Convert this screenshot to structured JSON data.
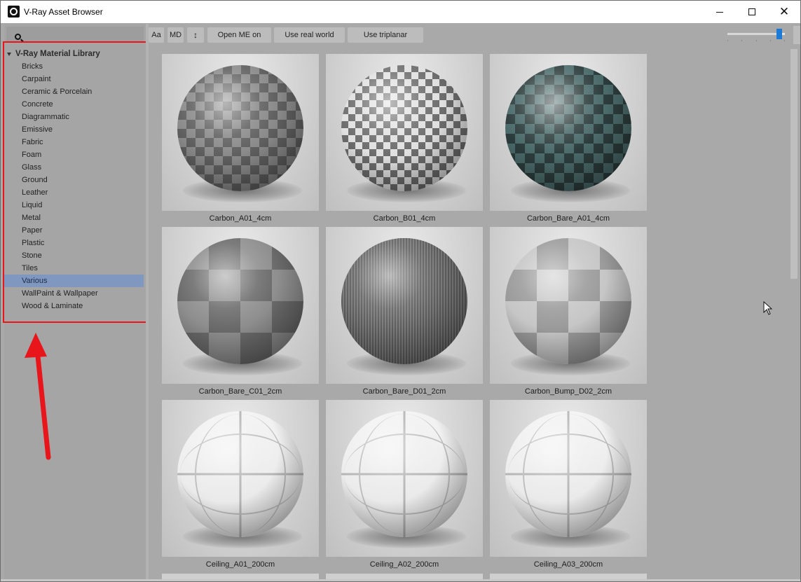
{
  "window": {
    "title": "V-Ray Asset Browser",
    "minimize_symbol": "",
    "close_symbol": "✕"
  },
  "search": {
    "placeholder": "",
    "value": ""
  },
  "tree": {
    "root_label": "V-Ray Material Library",
    "items": [
      {
        "label": "Bricks"
      },
      {
        "label": "Carpaint"
      },
      {
        "label": "Ceramic & Porcelain"
      },
      {
        "label": "Concrete"
      },
      {
        "label": "Diagrammatic"
      },
      {
        "label": "Emissive"
      },
      {
        "label": "Fabric"
      },
      {
        "label": "Foam"
      },
      {
        "label": "Glass"
      },
      {
        "label": "Ground"
      },
      {
        "label": "Leather"
      },
      {
        "label": "Liquid"
      },
      {
        "label": "Metal"
      },
      {
        "label": "Paper"
      },
      {
        "label": "Plastic"
      },
      {
        "label": "Stone"
      },
      {
        "label": "Tiles"
      },
      {
        "label": "Various",
        "selected": true
      },
      {
        "label": "WallPaint & Wallpaper"
      },
      {
        "label": "Wood & Laminate"
      }
    ]
  },
  "toolbar": {
    "aa_label": "Aa",
    "md_label": "MD",
    "sort_label": "↕",
    "open_me_label": "Open ME on apply",
    "real_world_label": "Use real world scale",
    "triplanar_label": "Use triplanar mapping",
    "thumbnail_size_fraction": 0.95
  },
  "materials": [
    {
      "name": "Carbon_A01_4cm",
      "pattern": "carbon-a"
    },
    {
      "name": "Carbon_B01_4cm",
      "pattern": "carbon-b"
    },
    {
      "name": "Carbon_Bare_A01_4cm",
      "pattern": "carbon-bare-a"
    },
    {
      "name": "Carbon_Bare_C01_2cm",
      "pattern": "carbon-c"
    },
    {
      "name": "Carbon_Bare_D01_2cm",
      "pattern": "carbon-d"
    },
    {
      "name": "Carbon_Bump_D02_2cm",
      "pattern": "carbon-bump"
    },
    {
      "name": "Ceiling_A01_200cm",
      "pattern": "ceiling"
    },
    {
      "name": "Ceiling_A02_200cm",
      "pattern": "ceiling"
    },
    {
      "name": "Ceiling_A03_200cm",
      "pattern": "ceiling"
    }
  ],
  "colors": {
    "selection": "#8097bf",
    "annotation_red": "#e8151b",
    "slider_accent": "#1b7bd6",
    "panel_bg": "#a9a9a9"
  }
}
